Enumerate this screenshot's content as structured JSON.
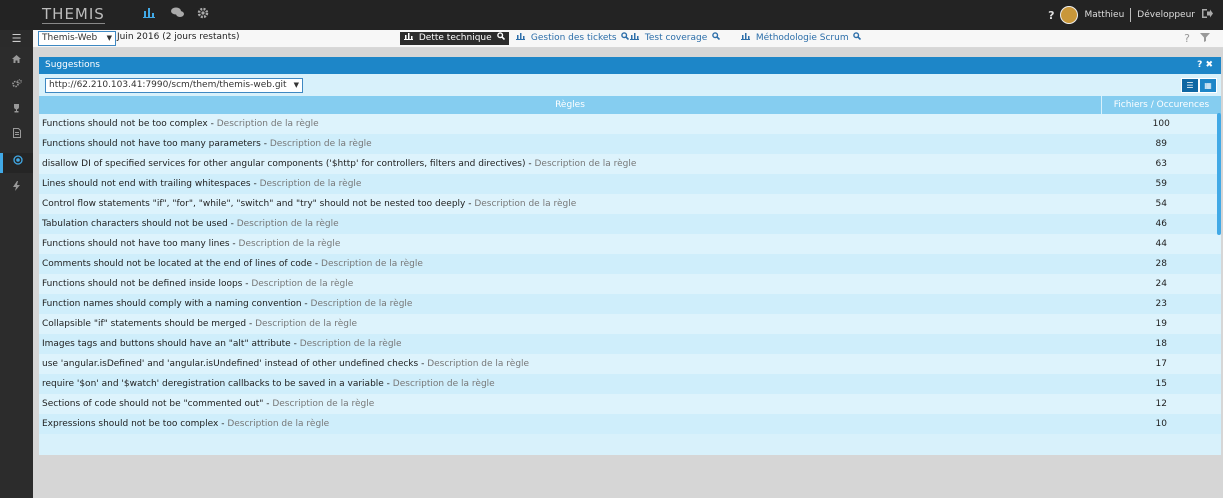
{
  "app": {
    "logo": "THEMIS"
  },
  "topbar": {
    "help": "?",
    "user": "Matthieu",
    "role": "Développeur"
  },
  "subbar": {
    "project": "Themis-Web",
    "period": "Juin 2016 (2 jours restants)",
    "tabs": [
      {
        "label": "Dette technique"
      },
      {
        "label": "Gestion des tickets"
      },
      {
        "label": "Test coverage"
      },
      {
        "label": "Méthodologie Scrum"
      }
    ],
    "help": "?"
  },
  "panel": {
    "title": "Suggestions",
    "controls": "? ✖",
    "repo": "http://62.210.103.41:7990/scm/them/themis-web.git"
  },
  "table": {
    "col_rules": "Règles",
    "col_count": "Fichiers / Occurences",
    "rows": [
      {
        "rule": "Functions should not be too complex - ",
        "desc": "Description de la règle",
        "count": "100"
      },
      {
        "rule": "Functions should not have too many parameters - ",
        "desc": "Description de la règle",
        "count": "89"
      },
      {
        "rule": "disallow DI of specified services for other angular components ('$http' for controllers, filters and directives) - ",
        "desc": "Description de la règle",
        "count": "63"
      },
      {
        "rule": "Lines should not end with trailing whitespaces - ",
        "desc": "Description de la règle",
        "count": "59"
      },
      {
        "rule": "Control flow statements \"if\", \"for\", \"while\", \"switch\" and \"try\" should not be nested too deeply - ",
        "desc": "Description de la règle",
        "count": "54"
      },
      {
        "rule": "Tabulation characters should not be used - ",
        "desc": "Description de la règle",
        "count": "46"
      },
      {
        "rule": "Functions should not have too many lines - ",
        "desc": "Description de la règle",
        "count": "44"
      },
      {
        "rule": "Comments should not be located at the end of lines of code - ",
        "desc": "Description de la règle",
        "count": "28"
      },
      {
        "rule": "Functions should not be defined inside loops - ",
        "desc": "Description de la règle",
        "count": "24"
      },
      {
        "rule": "Function names should comply with a naming convention - ",
        "desc": "Description de la règle",
        "count": "23"
      },
      {
        "rule": "Collapsible \"if\" statements should be merged - ",
        "desc": "Description de la règle",
        "count": "19"
      },
      {
        "rule": "Images tags and buttons should have an \"alt\" attribute - ",
        "desc": "Description de la règle",
        "count": "18"
      },
      {
        "rule": "use 'angular.isDefined' and 'angular.isUndefined' instead of other undefined checks - ",
        "desc": "Description de la règle",
        "count": "17"
      },
      {
        "rule": "require '$on' and '$watch' deregistration callbacks to be saved in a variable - ",
        "desc": "Description de la règle",
        "count": "15"
      },
      {
        "rule": "Sections of code should not be \"commented out\" - ",
        "desc": "Description de la règle",
        "count": "12"
      },
      {
        "rule": "Expressions should not be too complex - ",
        "desc": "Description de la règle",
        "count": "10"
      }
    ]
  },
  "colors": {
    "accent": "#1d86c8",
    "header_light": "#85cdf0",
    "row_bg": "#d8f1fb",
    "topbar": "#232323"
  }
}
